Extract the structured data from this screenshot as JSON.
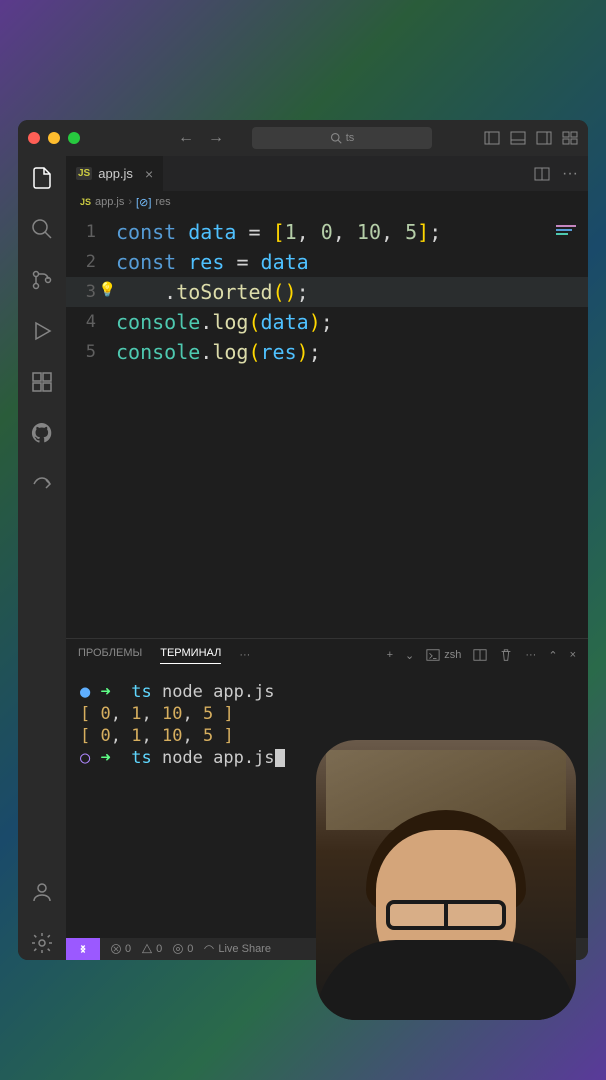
{
  "titlebar": {
    "search_text": "ts"
  },
  "tab": {
    "filename": "app.js",
    "icon_label": "JS"
  },
  "breadcrumb": {
    "file": "app.js",
    "file_icon": "JS",
    "symbol": "res",
    "symbol_icon": "[⊘]"
  },
  "code_lines": [
    {
      "n": "1",
      "html": "<span class='kw'>const</span> <span class='var'>data</span> <span class='op'>=</span> <span class='bracket1'>[</span><span class='num'>1</span><span class='punct'>,</span> <span class='num'>0</span><span class='punct'>,</span> <span class='num'>10</span><span class='punct'>,</span> <span class='num'>5</span><span class='bracket1'>]</span><span class='punct'>;</span>"
    },
    {
      "n": "2",
      "html": "<span class='kw'>const</span> <span class='var'>res</span> <span class='op'>=</span> <span class='var'>data</span>"
    },
    {
      "n": "3",
      "html": "    <span class='punct'>.</span><span class='func'>toSorted</span><span class='bracket1'>(</span><span class='bracket1'>)</span><span class='punct'>;</span>",
      "hl": true,
      "bulb": true
    },
    {
      "n": "4",
      "html": "<span class='obj'>console</span><span class='punct'>.</span><span class='func'>log</span><span class='bracket1'>(</span><span class='var'>data</span><span class='bracket1'>)</span><span class='punct'>;</span>"
    },
    {
      "n": "5",
      "html": "<span class='obj'>console</span><span class='punct'>.</span><span class='func'>log</span><span class='bracket1'>(</span><span class='var'>res</span><span class='bracket1'>)</span><span class='punct'>;</span>"
    }
  ],
  "panel": {
    "tab_problems": "ПРОБЛЕМЫ",
    "tab_terminal": "ТЕРМИНАЛ",
    "more": "···",
    "shell": "zsh"
  },
  "terminal_lines": [
    "<span class='t-dot1'>●</span> <span class='t-arrow'>➜</span>  <span class='t-cyan'>ts</span> node app.js",
    "<span class='t-yellow'>[</span> <span class='t-num'>0</span>, <span class='t-num'>1</span>, <span class='t-num'>10</span>, <span class='t-num'>5</span> <span class='t-yellow'>]</span>",
    "<span class='t-yellow'>[</span> <span class='t-num'>0</span>, <span class='t-num'>1</span>, <span class='t-num'>10</span>, <span class='t-num'>5</span> <span class='t-yellow'>]</span>",
    "<span class='t-dot2'>○</span> <span class='t-arrow'>➜</span>  <span class='t-cyan'>ts</span> node app.js<span class='t-cursor'></span>"
  ],
  "statusbar": {
    "errors": "0",
    "warnings": "0",
    "ports": "0",
    "liveshare": "Live Share"
  }
}
